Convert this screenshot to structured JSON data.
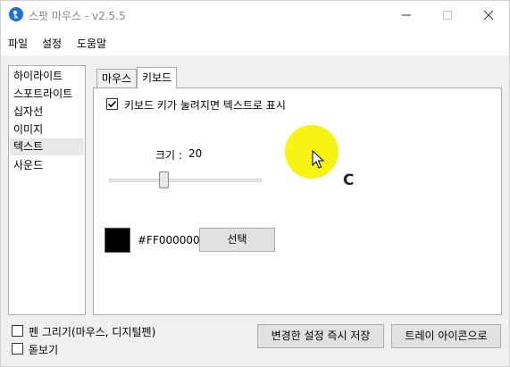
{
  "window": {
    "title": "스팟 마우스 - v2.5.5"
  },
  "menu": [
    "파일",
    "설정",
    "도움말"
  ],
  "sidebar": {
    "items": [
      "하이라이트",
      "스포트라이트",
      "십자선",
      "이미지",
      "텍스트",
      "사운드"
    ],
    "selected": "텍스트"
  },
  "tabs": {
    "labels": [
      "마우스",
      "키보드"
    ],
    "active": "키보드"
  },
  "keyboard": {
    "show_text_label": "키보드 키가 눌려지면 텍스트로 표시",
    "show_text_checked": true,
    "size_label": "크기 :",
    "size_value": "20",
    "size_level": 0.35,
    "color_hex": "#FF000000",
    "select_label": "선택",
    "preview_char": "C"
  },
  "bottom": {
    "pen_label": "펜 그리기(마우스, 디지털펜)",
    "pen_checked": false,
    "magnifier_label": "돋보기",
    "magnifier_checked": false,
    "apply_label": "변경한 설정 즉시 저장",
    "tray_label": "트레이 아이콘으로"
  },
  "colors": {
    "spotlight": "#f7f415",
    "swatch": "#000000",
    "app_icon": "#1e6fd9"
  },
  "icons": {
    "app": "spot-mouse-app-icon",
    "minimize": "minimize-icon",
    "maximize": "maximize-icon",
    "close": "close-icon",
    "check": "checkmark-icon",
    "pointer": "mouse-pointer-icon"
  }
}
